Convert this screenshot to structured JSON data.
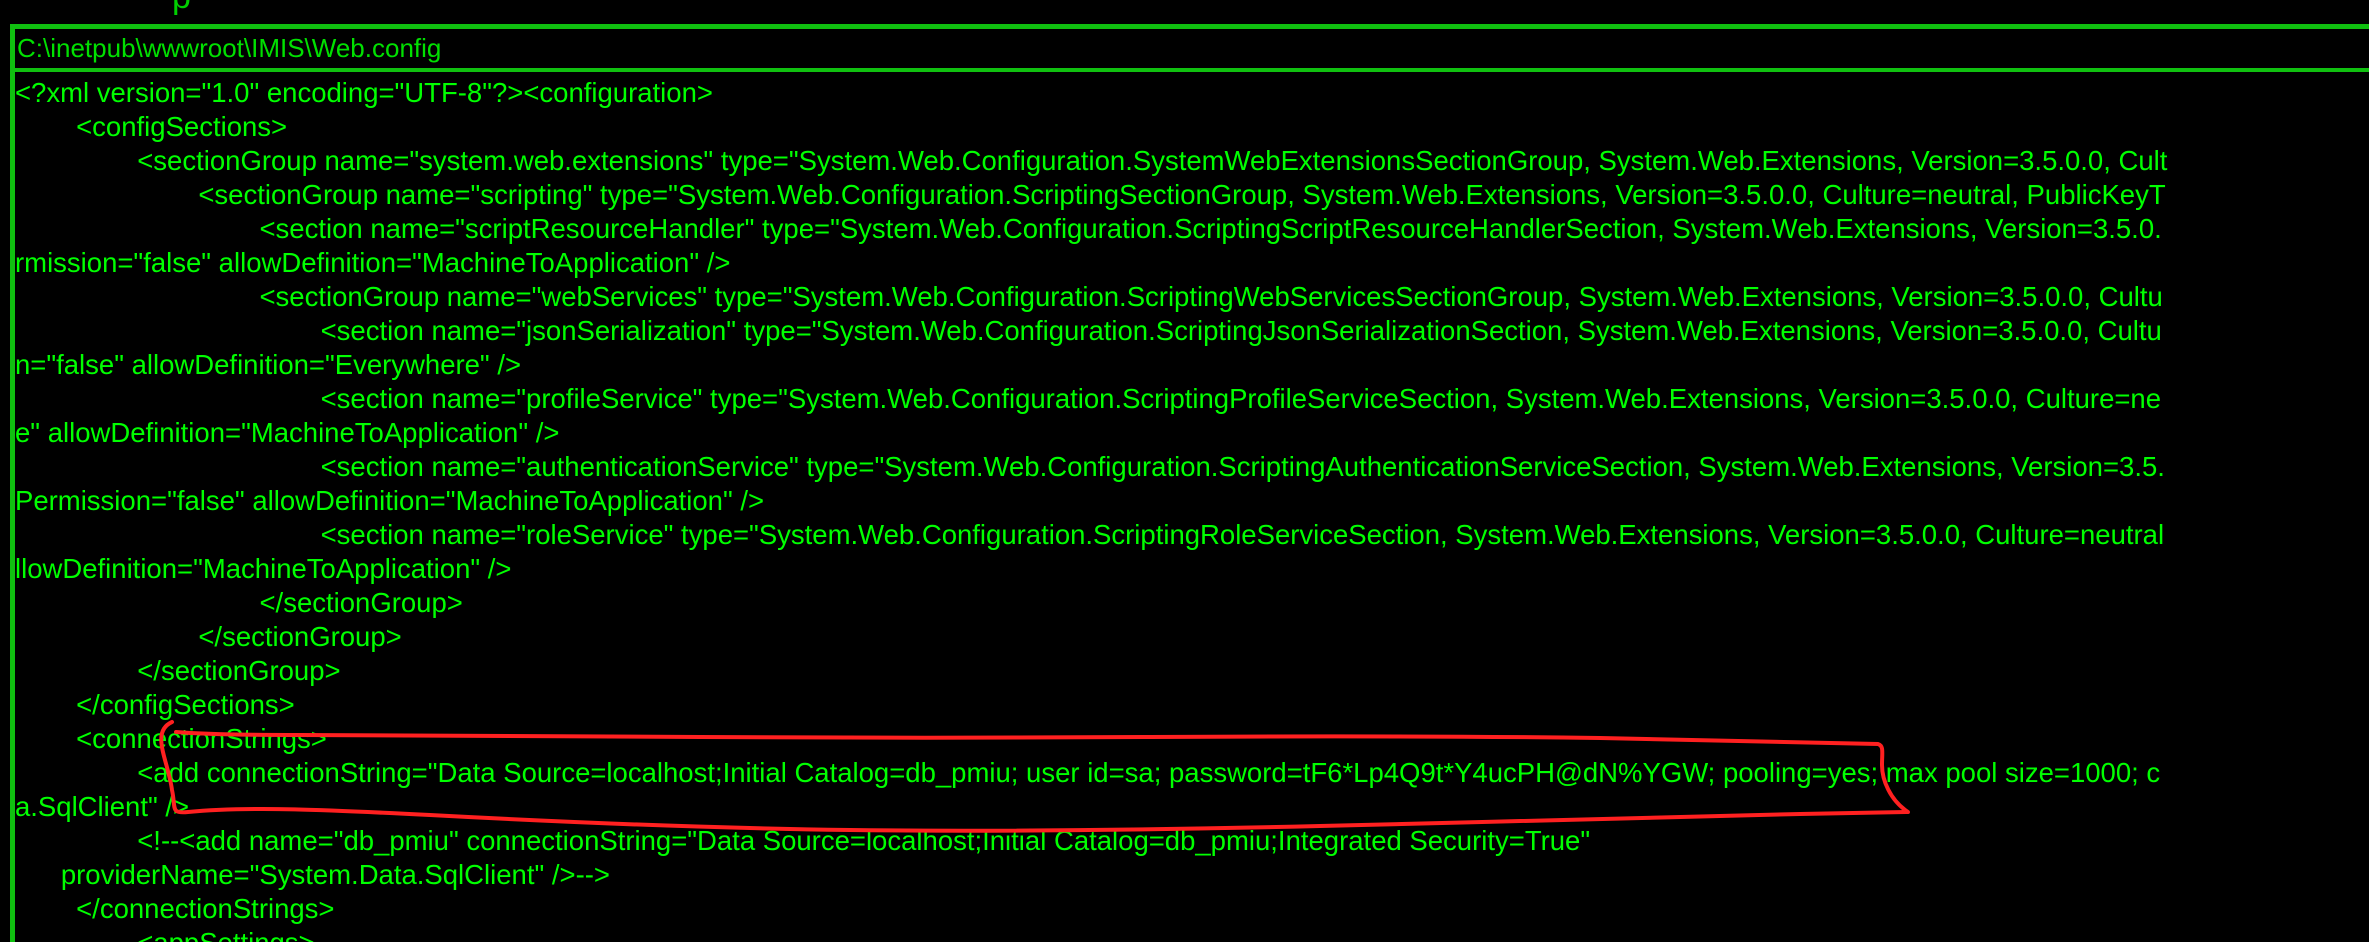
{
  "window": {
    "top_fragment": "p",
    "file_path": "C:\\inetpub\\wwwroot\\IMIS\\Web.config"
  },
  "colors": {
    "text": "#00ff00",
    "frame": "#10c010",
    "background": "#000000",
    "annotation": "#ff2020"
  },
  "code_lines": [
    "<?xml version=\"1.0\" encoding=\"UTF-8\"?><configuration>",
    "        <configSections>",
    "                <sectionGroup name=\"system.web.extensions\" type=\"System.Web.Configuration.SystemWebExtensionsSectionGroup, System.Web.Extensions, Version=3.5.0.0, Cult",
    "                        <sectionGroup name=\"scripting\" type=\"System.Web.Configuration.ScriptingSectionGroup, System.Web.Extensions, Version=3.5.0.0, Culture=neutral, PublicKeyT",
    "                                <section name=\"scriptResourceHandler\" type=\"System.Web.Configuration.ScriptingScriptResourceHandlerSection, System.Web.Extensions, Version=3.5.0.",
    "rmission=\"false\" allowDefinition=\"MachineToApplication\" />",
    "                                <sectionGroup name=\"webServices\" type=\"System.Web.Configuration.ScriptingWebServicesSectionGroup, System.Web.Extensions, Version=3.5.0.0, Cultu",
    "                                        <section name=\"jsonSerialization\" type=\"System.Web.Configuration.ScriptingJsonSerializationSection, System.Web.Extensions, Version=3.5.0.0, Cultu",
    "n=\"false\" allowDefinition=\"Everywhere\" />",
    "                                        <section name=\"profileService\" type=\"System.Web.Configuration.ScriptingProfileServiceSection, System.Web.Extensions, Version=3.5.0.0, Culture=ne",
    "e\" allowDefinition=\"MachineToApplication\" />",
    "                                        <section name=\"authenticationService\" type=\"System.Web.Configuration.ScriptingAuthenticationServiceSection, System.Web.Extensions, Version=3.5.",
    "Permission=\"false\" allowDefinition=\"MachineToApplication\" />",
    "                                        <section name=\"roleService\" type=\"System.Web.Configuration.ScriptingRoleServiceSection, System.Web.Extensions, Version=3.5.0.0, Culture=neutral",
    "llowDefinition=\"MachineToApplication\" />",
    "                                </sectionGroup>",
    "                        </sectionGroup>",
    "                </sectionGroup>",
    "        </configSections>",
    "        <connectionStrings>",
    "                <add connectionString=\"Data Source=localhost;Initial Catalog=db_pmiu; user id=sa; password=tF6*Lp4Q9t*Y4ucPH@dN%YGW; pooling=yes; max pool size=1000; c",
    "a.SqlClient\" />",
    "                <!--<add name=\"db_pmiu\" connectionString=\"Data Source=localhost;Initial Catalog=db_pmiu;Integrated Security=True\"",
    "      providerName=\"System.Data.SqlClient\" />-->",
    "        </connectionStrings>",
    "                <appSettings>"
  ]
}
